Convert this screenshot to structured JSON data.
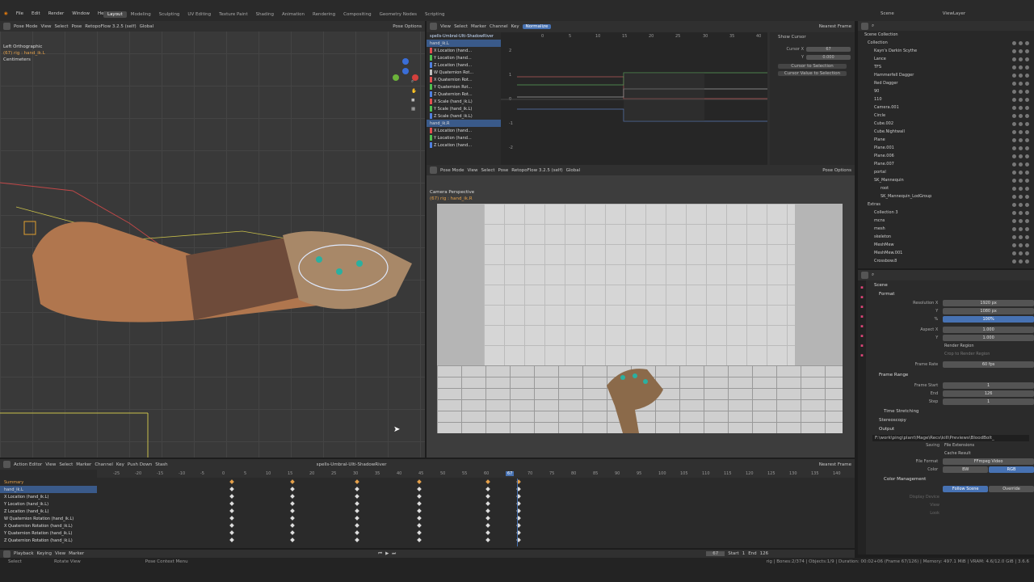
{
  "topbar": {
    "menus": [
      "File",
      "Edit",
      "Render",
      "Window",
      "Help"
    ],
    "workspaces": [
      "Layout",
      "Modeling",
      "Sculpting",
      "UV Editing",
      "Texture Paint",
      "Shading",
      "Animation",
      "Rendering",
      "Compositing",
      "Geometry Nodes",
      "Scripting"
    ],
    "active_workspace": "Layout",
    "scene": "Scene",
    "view_layer": "ViewLayer"
  },
  "viewport_left": {
    "mode": "Pose Mode",
    "menus": [
      "View",
      "Select",
      "Pose"
    ],
    "action": "RetopoFlow 3.2.5 (self)",
    "orientation": "Global",
    "pose_options": "Pose Options",
    "title": "Left Orthographic",
    "subtitle": "(67) rig : hand_ik.L",
    "units": "Centimeters"
  },
  "graph": {
    "menus": [
      "View",
      "Select",
      "Marker",
      "Channel",
      "Key"
    ],
    "normalize": "Normalize",
    "snap": "Nearest Frame",
    "action_name": "spells-Umbral-Ulti-ShadowRiver",
    "bone": "hand_ik.L",
    "bone2": "hand_ik.R",
    "channels": [
      "X Location (hand...",
      "Y Location (hand...",
      "Z Location (hand...",
      "W Quaternion Rot...",
      "X Quaternion Rot...",
      "Y Quaternion Rot...",
      "Z Quaternion Rot...",
      "X Scale (hand_ik.L)",
      "Y Scale (hand_ik.L)",
      "Z Scale (hand_ik.L)"
    ],
    "channels2": [
      "X Location (hand...",
      "Y Location (hand...",
      "Z Location (hand..."
    ],
    "ruler": [
      "0",
      "5",
      "10",
      "15",
      "20",
      "25",
      "30",
      "35",
      "40"
    ],
    "yticks": [
      "2",
      "1",
      "0",
      "-1",
      "-2"
    ],
    "show_cursor": "Show Cursor",
    "cursor_x_label": "Cursor X",
    "cursor_x": "67",
    "cursor_y_label": "Y",
    "cursor_y": "0.000",
    "cursor_to_selection": "Cursor to Selection",
    "cursor_value_to_selection": "Cursor Value to Selection"
  },
  "viewport_cam": {
    "mode": "Pose Mode",
    "menus": [
      "View",
      "Select",
      "Pose"
    ],
    "action": "RetopoFlow 3.2.5 (self)",
    "orientation": "Global",
    "pose_options": "Pose Options",
    "title": "Camera Perspective",
    "subtitle": "(67) rig : hand_ik.R"
  },
  "outliner": {
    "header": "Scene Collection",
    "rows": [
      {
        "name": "Collection",
        "level": 1
      },
      {
        "name": "Kayn's Darkin Scythe",
        "level": 2
      },
      {
        "name": "Lance",
        "level": 2
      },
      {
        "name": "TFS",
        "level": 2
      },
      {
        "name": "Hammerfell Dagger",
        "level": 2
      },
      {
        "name": "Red Dagger",
        "level": 2
      },
      {
        "name": "90",
        "level": 2
      },
      {
        "name": "110",
        "level": 2
      },
      {
        "name": "Camera.001",
        "level": 2
      },
      {
        "name": "Circle",
        "level": 2
      },
      {
        "name": "Cube.002",
        "level": 2
      },
      {
        "name": "Cube.Nightwall",
        "level": 2
      },
      {
        "name": "Plane",
        "level": 2
      },
      {
        "name": "Plane.001",
        "level": 2
      },
      {
        "name": "Plane.006",
        "level": 2
      },
      {
        "name": "Plane.007",
        "level": 2
      },
      {
        "name": "portal",
        "level": 2
      },
      {
        "name": "SK_Mannequin",
        "level": 2
      },
      {
        "name": "root",
        "level": 3
      },
      {
        "name": "SK_Mannequin_LodGroup",
        "level": 3
      },
      {
        "name": "Extras",
        "level": 1
      },
      {
        "name": "Collection 3",
        "level": 2
      },
      {
        "name": "mcns",
        "level": 2
      },
      {
        "name": "mesh",
        "level": 2
      },
      {
        "name": "skeleton",
        "level": 2
      },
      {
        "name": "MeshMew",
        "level": 2
      },
      {
        "name": "MeshMew.001",
        "level": 2
      },
      {
        "name": "Crossbow.8",
        "level": 2
      }
    ]
  },
  "properties": {
    "scene": "Scene",
    "format": "Format",
    "res_x_label": "Resolution X",
    "res_x": "1920 px",
    "res_y_label": "Y",
    "res_y": "1080 px",
    "res_pct_label": "%",
    "res_pct": "100%",
    "aspect_x_label": "Aspect X",
    "aspect_x": "1.000",
    "aspect_y_label": "Y",
    "aspect_y": "1.000",
    "render_region": "Render Region",
    "crop": "Crop to Render Region",
    "frame_rate_label": "Frame Rate",
    "frame_rate": "60 fps",
    "frame_range": "Frame Range",
    "frame_start_label": "Frame Start",
    "frame_start": "1",
    "end_label": "End",
    "end": "126",
    "step_label": "Step",
    "step": "1",
    "time_stretching": "Time Stretching",
    "stereoscopy": "Stereoscopy",
    "output": "Output",
    "output_path": "F:\\work\\ping\\plant\\Mage\\Recs\\kill\\Previews\\BloodBolt_",
    "saving_label": "Saving",
    "file_ext": "File Extensions",
    "cache_result": "Cache Result",
    "file_format_label": "File Format",
    "file_format": "FFmpeg Video",
    "color_label": "Color",
    "bw": "BW",
    "rgb": "RGB",
    "color_mgmt": "Color Management",
    "follow_scene": "Follow Scene",
    "override": "Override",
    "display_device": "Display Device",
    "view": "View",
    "look": "Look"
  },
  "dopesheet": {
    "mode": "Action Editor",
    "menus": [
      "View",
      "Select",
      "Marker",
      "Channel",
      "Key"
    ],
    "push_down": "Push Down",
    "stash": "Stash",
    "action_name": "spells-Umbral-Ulti-ShadowRiver",
    "snap": "Nearest Frame",
    "channels": [
      "Summary",
      "hand_ik.L",
      "X Location (hand_ik.L)",
      "Y Location (hand_ik.L)",
      "Z Location (hand_ik.L)",
      "W Quaternion Rotation (hand_ik.L)",
      "X Quaternion Rotation (hand_ik.L)",
      "Y Quaternion Rotation (hand_ik.L)",
      "Z Quaternion Rotation (hand_ik.L)"
    ],
    "ruler": [
      "-25",
      "-20",
      "-15",
      "-10",
      "-5",
      "0",
      "5",
      "10",
      "15",
      "20",
      "25",
      "30",
      "35",
      "40",
      "45",
      "50",
      "55",
      "60",
      "67",
      "70",
      "75",
      "80",
      "85",
      "90",
      "95",
      "100",
      "105",
      "110",
      "115",
      "120",
      "125",
      "130",
      "135",
      "140"
    ],
    "current_frame": "67"
  },
  "timeline": {
    "menus": [
      "Playback",
      "Keying",
      "View",
      "Marker"
    ],
    "frame": "67",
    "start_label": "Start",
    "start": "1",
    "end_label": "End",
    "end": "126"
  },
  "statusbar": {
    "select": "Select",
    "rotate": "Rotate View",
    "context": "Pose Context Menu",
    "stats": "rig | Bones:2/374 | Objects:1/9 | Duration: 00:02+06 (Frame 67/126) | Memory: 497.1 MiB | VRAM: 4.6/12.0 GiB | 3.6.6"
  }
}
